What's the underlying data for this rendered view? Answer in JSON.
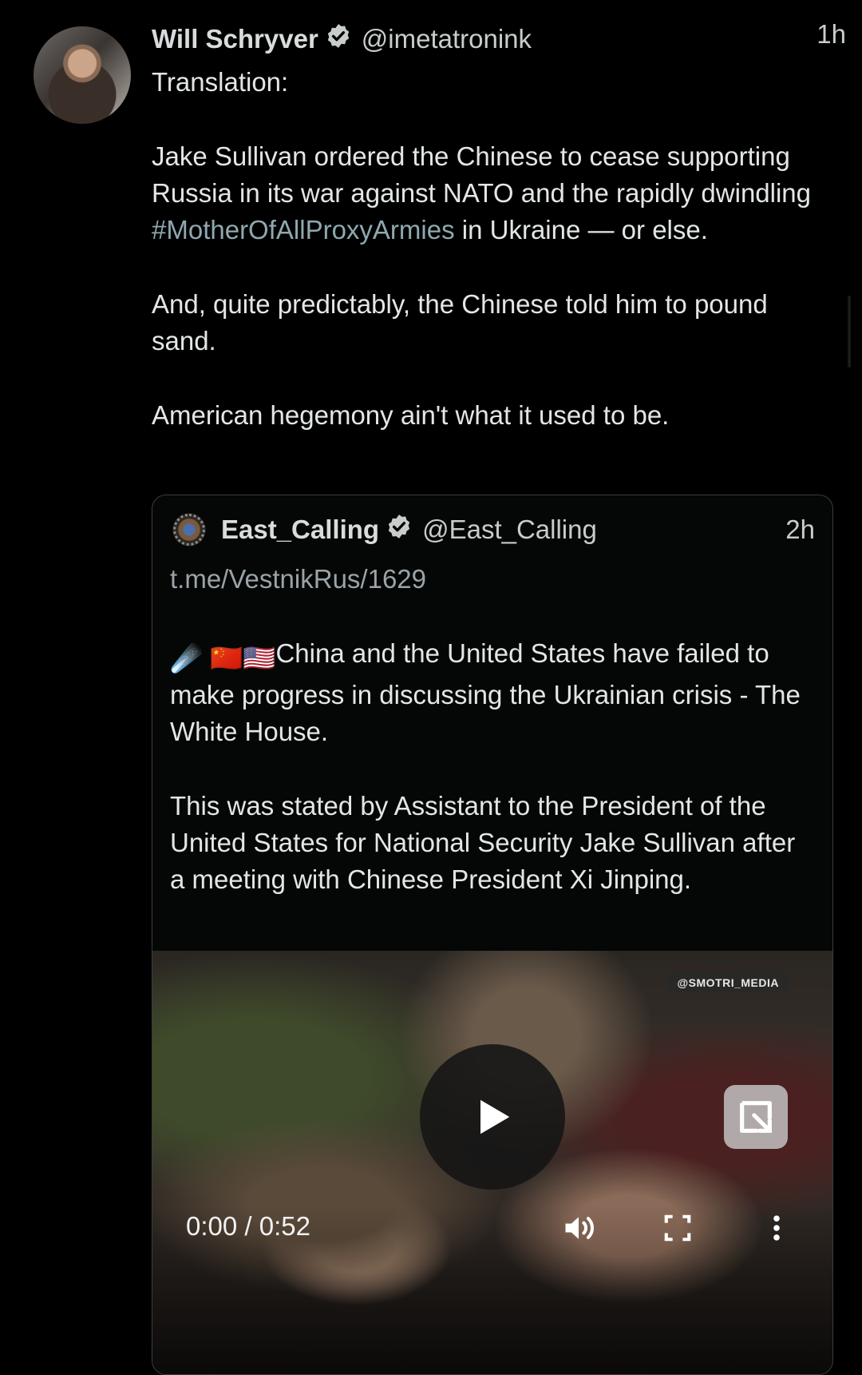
{
  "post": {
    "author_name": "Will Schryver",
    "author_handle": "@imetatronink",
    "time": "1h",
    "paragraphs": {
      "p1": "Translation:",
      "p2_a": "Jake Sullivan ordered the Chinese to cease supporting Russia in its war against NATO and the rapidly dwindling ",
      "p2_hashtag": "#MotherOfAllProxyArmies",
      "p2_b": " in Ukraine — or else.",
      "p3": "And, quite predictably, the Chinese told him to pound sand.",
      "p4": "American hegemony ain't what it used to be."
    }
  },
  "quote": {
    "author_name": "East_Calling",
    "author_handle": "@East_Calling",
    "time": "2h",
    "link": "t.me/VestnikRus/1629",
    "p1": "China and the United States have failed to make progress in discussing the Ukrainian crisis - The White House.",
    "p2": "This was stated by Assistant to the President of the United States for National Security Jake Sullivan after a meeting with Chinese President Xi Jinping.",
    "emojis": {
      "comet": "☄️",
      "flag_cn": "🇨🇳",
      "flag_us": "🇺🇸"
    }
  },
  "video": {
    "watermark": "@SMOTRI_MEDIA",
    "time_display": "0:00 / 0:52"
  },
  "colors": {
    "background": "#000000",
    "text": "#e3e6e7",
    "hashtag": "#8fa8b0",
    "verified_badge": "#c8cccd"
  },
  "icons": {
    "verified": "verified-badge-icon",
    "play": "play-icon",
    "popout": "popout-icon",
    "volume": "volume-icon",
    "fullscreen": "fullscreen-icon",
    "more": "more-vertical-icon"
  }
}
